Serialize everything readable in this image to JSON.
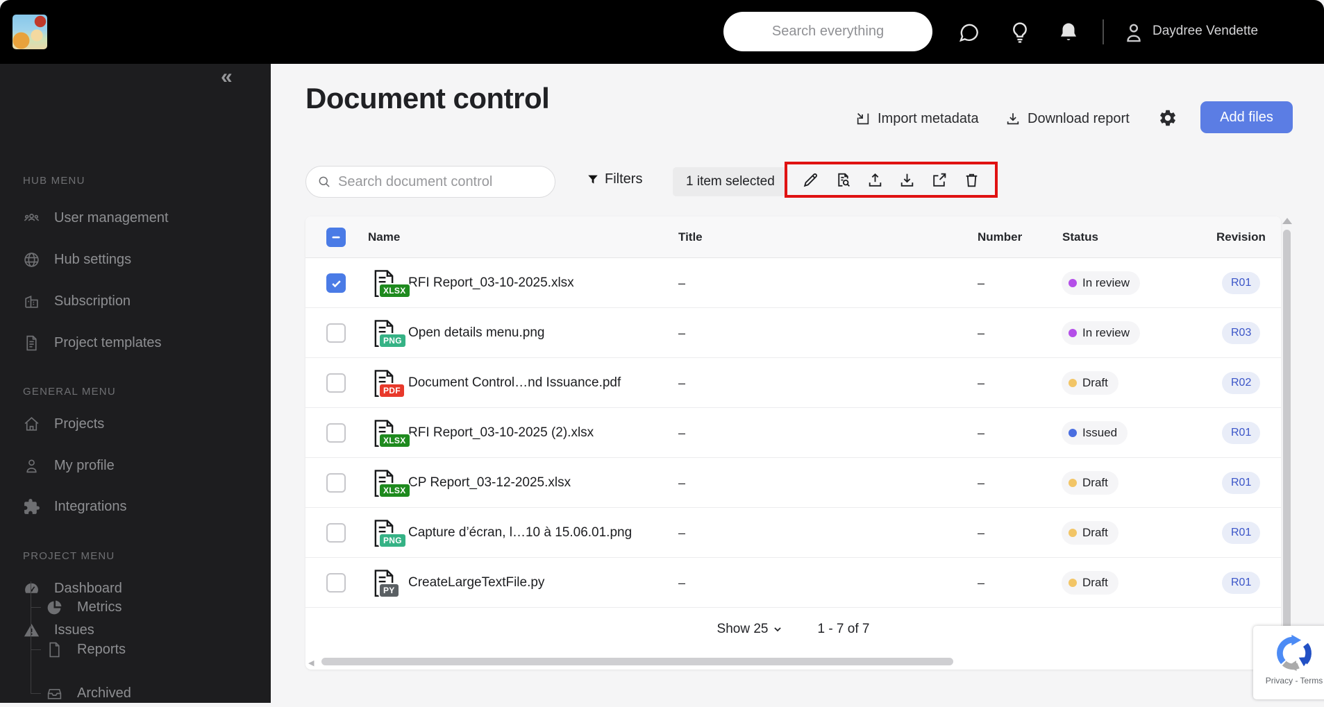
{
  "header": {
    "search_placeholder": "Search everything",
    "user_name": "Daydree Vendette",
    "icons": [
      "chat-icon",
      "lightbulb-icon",
      "bell-icon",
      "user-icon"
    ]
  },
  "sidebar": {
    "collapse_glyph": "«",
    "sections": [
      {
        "label": "HUB MENU",
        "items": [
          {
            "label": "User management",
            "icon": "users-icon"
          },
          {
            "label": "Hub settings",
            "icon": "globe-icon"
          },
          {
            "label": "Subscription",
            "icon": "building-icon"
          },
          {
            "label": "Project templates",
            "icon": "document-icon"
          }
        ]
      },
      {
        "label": "GENERAL MENU",
        "items": [
          {
            "label": "Projects",
            "icon": "home-icon"
          },
          {
            "label": "My profile",
            "icon": "person-icon"
          },
          {
            "label": "Integrations",
            "icon": "puzzle-icon"
          }
        ]
      },
      {
        "label": "PROJECT MENU",
        "items": [
          {
            "label": "Dashboard",
            "icon": "gauge-icon"
          },
          {
            "label": "Issues",
            "icon": "warning-icon"
          }
        ],
        "subitems": [
          {
            "label": "Metrics",
            "icon": "pie-chart-icon"
          },
          {
            "label": "Reports",
            "icon": "file-icon"
          },
          {
            "label": "Archived",
            "icon": "archive-icon"
          }
        ]
      }
    ]
  },
  "page": {
    "title": "Document control",
    "import_label": "Import metadata",
    "download_label": "Download report",
    "add_files_label": "Add files",
    "search_placeholder": "Search document control",
    "filters_label": "Filters",
    "selection_label": "1 item selected",
    "toolbar_icons": [
      "edit-icon",
      "file-preview-icon",
      "upload-icon",
      "download-icon",
      "share-icon",
      "delete-icon"
    ],
    "annotation_color": "#e01212",
    "accent_color": "#5b7de4"
  },
  "table": {
    "columns": [
      "Name",
      "Title",
      "Number",
      "Status",
      "Revision"
    ],
    "badge_colors": {
      "XLSX": "#1e8a1e",
      "PNG": "#35b285",
      "PDF": "#e8392b",
      "PY": "#5a5f63"
    },
    "status_colors": {
      "In review": "#b44fe8",
      "Issued": "#4a6ee0",
      "Draft": "#f2c566"
    },
    "rows": [
      {
        "checked": true,
        "file_type": "XLSX",
        "name": "RFI Report_03-10-2025.xlsx",
        "title": "–",
        "number": "–",
        "status": "In review",
        "revision": "R01"
      },
      {
        "checked": false,
        "file_type": "PNG",
        "name": "Open details menu.png",
        "title": "–",
        "number": "–",
        "status": "In review",
        "revision": "R03"
      },
      {
        "checked": false,
        "file_type": "PDF",
        "name": "Document Control…nd Issuance.pdf",
        "title": "–",
        "number": "–",
        "status": "Draft",
        "revision": "R02"
      },
      {
        "checked": false,
        "file_type": "XLSX",
        "name": "RFI Report_03-10-2025 (2).xlsx",
        "title": "–",
        "number": "–",
        "status": "Issued",
        "revision": "R01"
      },
      {
        "checked": false,
        "file_type": "XLSX",
        "name": "CP Report_03-12-2025.xlsx",
        "title": "–",
        "number": "–",
        "status": "Draft",
        "revision": "R01"
      },
      {
        "checked": false,
        "file_type": "PNG",
        "name": "Capture d’écran, l…10 à 15.06.01.png",
        "title": "–",
        "number": "–",
        "status": "Draft",
        "revision": "R01"
      },
      {
        "checked": false,
        "file_type": "PY",
        "name": "CreateLargeTextFile.py",
        "title": "–",
        "number": "–",
        "status": "Draft",
        "revision": "R01"
      }
    ],
    "pagination": {
      "show_label": "Show 25",
      "range_label": "1 - 7 of 7"
    }
  },
  "recaptcha": {
    "terms_label": "Privacy - Terms"
  }
}
